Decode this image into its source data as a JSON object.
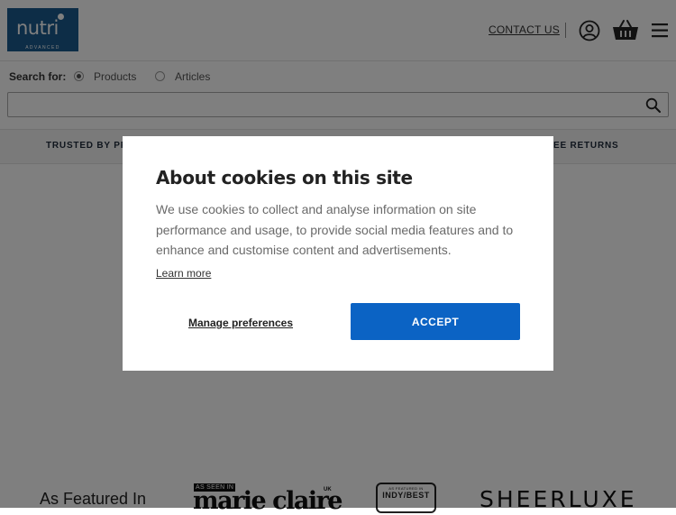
{
  "header": {
    "logo": {
      "word": "nutri",
      "sub": "ADVANCED"
    },
    "contact_label": "CONTACT US",
    "icons": {
      "account": "account-icon",
      "basket": "basket-icon",
      "menu": "menu-icon"
    }
  },
  "search": {
    "label": "Search for:",
    "options": [
      {
        "label": "Products",
        "selected": true
      },
      {
        "label": "Articles",
        "selected": false
      }
    ],
    "value": "",
    "placeholder": ""
  },
  "promo": {
    "left_text": "TRUSTED BY PRO",
    "right_text": "EE RETURNS"
  },
  "featured": {
    "title": "As Featured In",
    "press": {
      "marie_claire_tag": "AS SEEN IN",
      "marie_claire": "marie claire",
      "marie_claire_region": "UK",
      "indy_small": "AS FEATURED IN",
      "indy": "INDY/BEST",
      "sheerluxe": "SHEERLUXE"
    }
  },
  "cookie_modal": {
    "title": "About cookies on this site",
    "body": "We use cookies to collect and analyse information on site performance and usage, to provide social media features and to enhance and customise content and advertisements.",
    "learn_more": "Learn more",
    "manage_label": "Manage preferences",
    "accept_label": "ACCEPT"
  },
  "colors": {
    "brand": "#1b5b8e",
    "accept": "#0b63c4",
    "overlay": "rgba(0,0,0,0.5)"
  }
}
